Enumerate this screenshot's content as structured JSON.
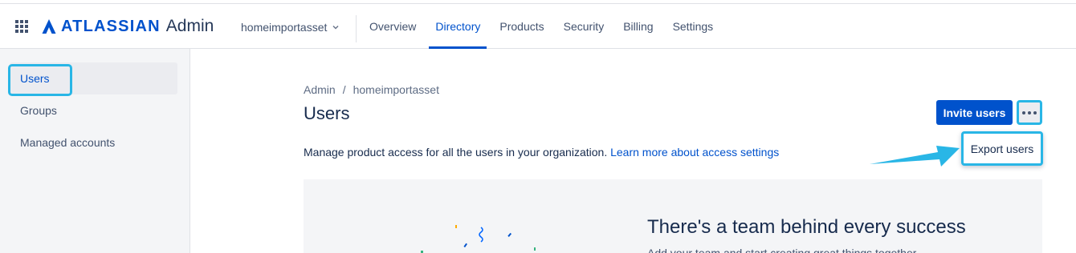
{
  "header": {
    "logo_brand": "ATLASSIAN",
    "logo_suffix": "Admin",
    "org_name": "homeimportasset",
    "nav": [
      {
        "label": "Overview",
        "active": false
      },
      {
        "label": "Directory",
        "active": true
      },
      {
        "label": "Products",
        "active": false
      },
      {
        "label": "Security",
        "active": false
      },
      {
        "label": "Billing",
        "active": false
      },
      {
        "label": "Settings",
        "active": false
      }
    ]
  },
  "sidebar": {
    "items": [
      {
        "label": "Users",
        "active": true
      },
      {
        "label": "Groups",
        "active": false
      },
      {
        "label": "Managed accounts",
        "active": false
      }
    ]
  },
  "breadcrumb": [
    "Admin",
    "homeimportasset"
  ],
  "page": {
    "title": "Users",
    "description": "Manage product access for all the users in your organization.",
    "learn_more_link": "Learn more about access settings",
    "invite_button": "Invite users",
    "more_menu_item": "Export users"
  },
  "banner": {
    "title": "There's a team behind every success",
    "text": "Add your team and start creating great things together"
  },
  "colors": {
    "brand": "#0052cc",
    "highlight": "#29b6e6",
    "sidebar_bg": "#f4f5f7"
  },
  "icons": [
    "app-switcher-icon",
    "atlassian-logo-icon",
    "chevron-down-icon",
    "more-icon",
    "arrow-annotation-icon"
  ]
}
